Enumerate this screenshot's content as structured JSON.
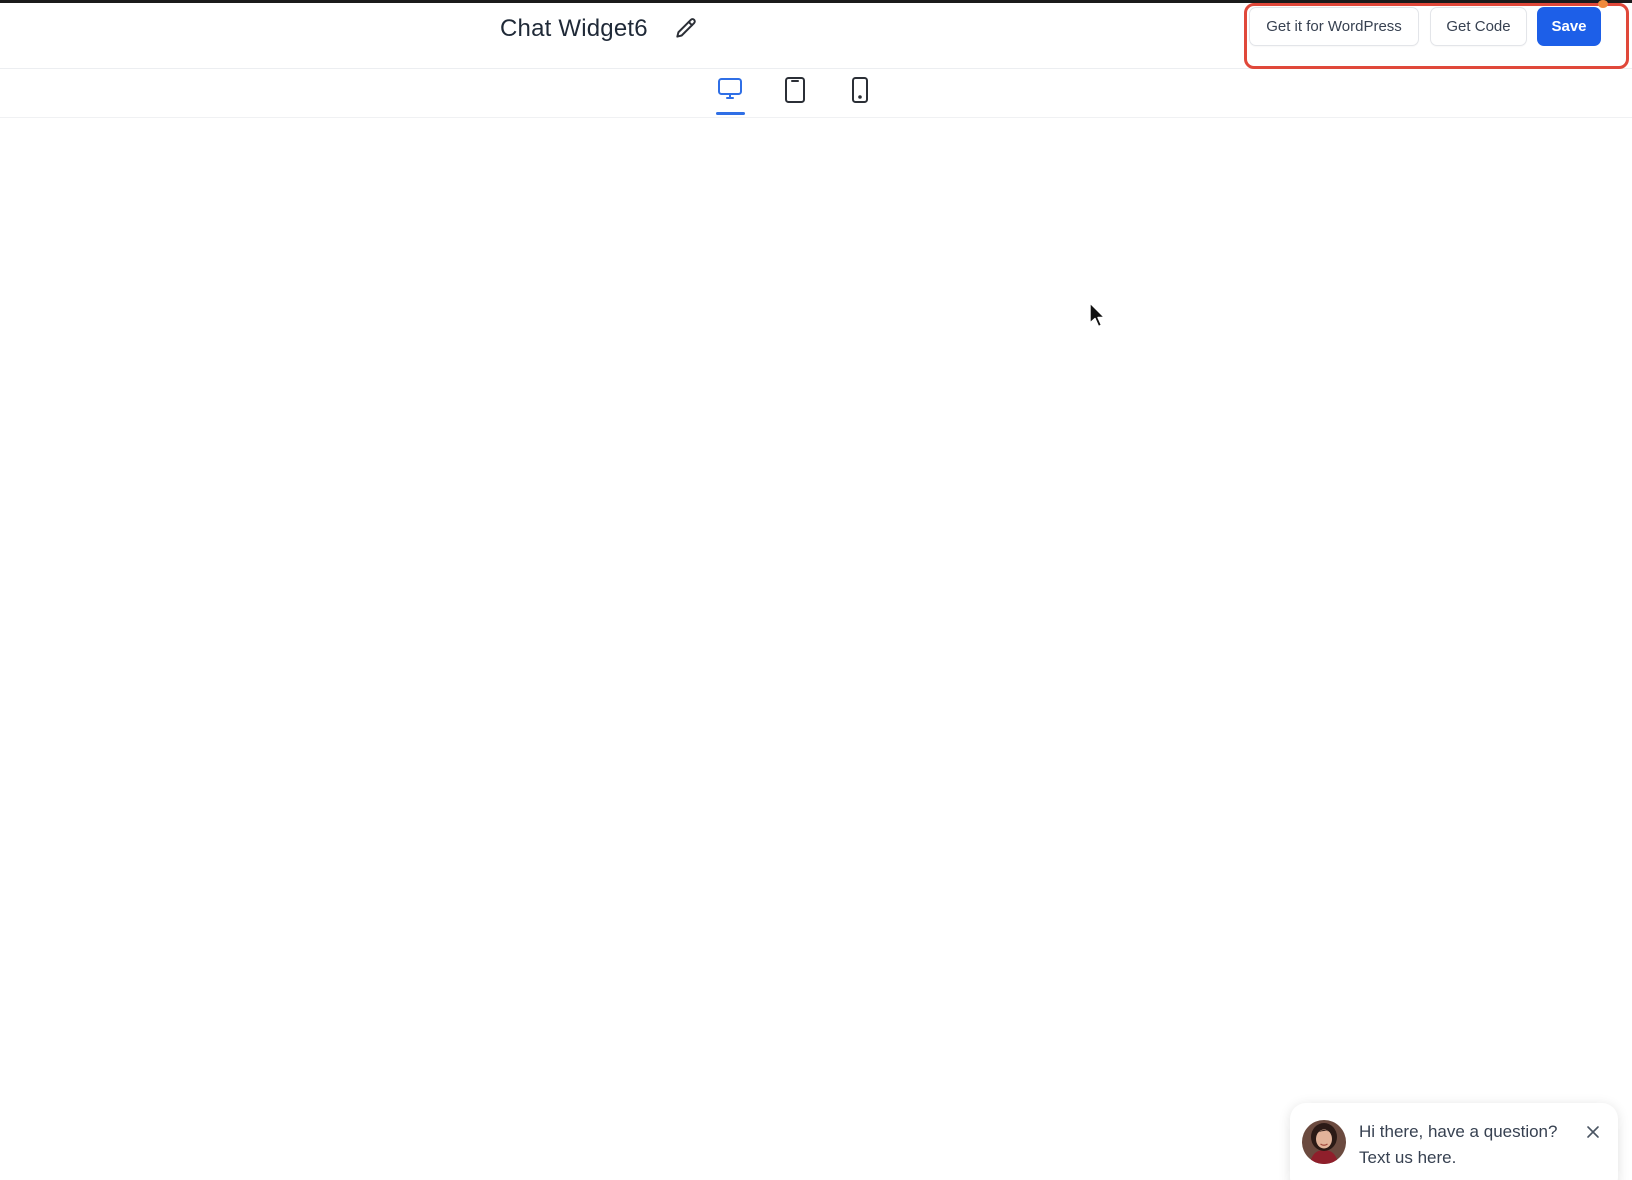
{
  "header": {
    "title": "Chat Widget6",
    "actions": {
      "wordpress_label": "Get it for WordPress",
      "code_label": "Get Code",
      "save_label": "Save"
    }
  },
  "device_tabs": {
    "items": [
      {
        "icon": "desktop-icon",
        "active": true
      },
      {
        "icon": "tablet-icon",
        "active": false
      },
      {
        "icon": "mobile-icon",
        "active": false
      }
    ]
  },
  "chat_popup": {
    "line1": "Hi there, have a question?",
    "line2": "Text us here."
  },
  "colors": {
    "primary": "#1d5fe8",
    "active_tab": "#2f6fe6",
    "highlight": "#e0483a"
  }
}
